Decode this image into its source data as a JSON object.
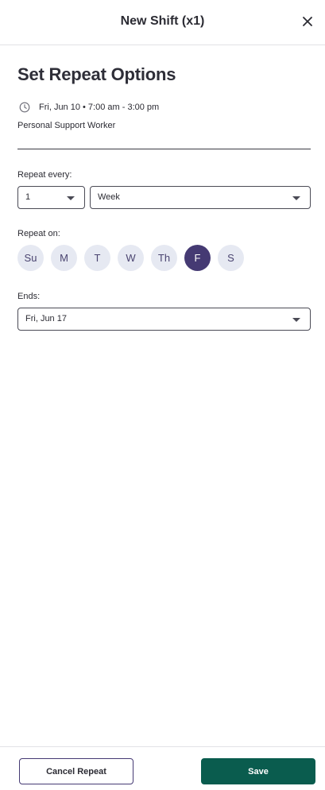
{
  "header": {
    "title": "New Shift (x1)",
    "close_icon": "close-icon"
  },
  "main": {
    "title": "Set Repeat Options",
    "shift": {
      "time_icon": "clock-icon",
      "time": "Fri, Jun 10 • 7:00 am - 3:00 pm",
      "role": "Personal Support Worker"
    },
    "repeat_every": {
      "label": "Repeat every:",
      "interval_value": "1",
      "unit_value": "Week"
    },
    "repeat_on": {
      "label": "Repeat on:",
      "days": [
        {
          "label": "Su",
          "selected": false
        },
        {
          "label": "M",
          "selected": false
        },
        {
          "label": "T",
          "selected": false
        },
        {
          "label": "W",
          "selected": false
        },
        {
          "label": "Th",
          "selected": false
        },
        {
          "label": "F",
          "selected": true
        },
        {
          "label": "S",
          "selected": false
        }
      ]
    },
    "ends": {
      "label": "Ends:",
      "value": "Fri, Jun 17"
    }
  },
  "footer": {
    "cancel_label": "Cancel Repeat",
    "save_label": "Save"
  },
  "colors": {
    "accent_purple": "#453a73",
    "save_green": "#0a5c4e",
    "day_bg": "#e6e9f2"
  }
}
